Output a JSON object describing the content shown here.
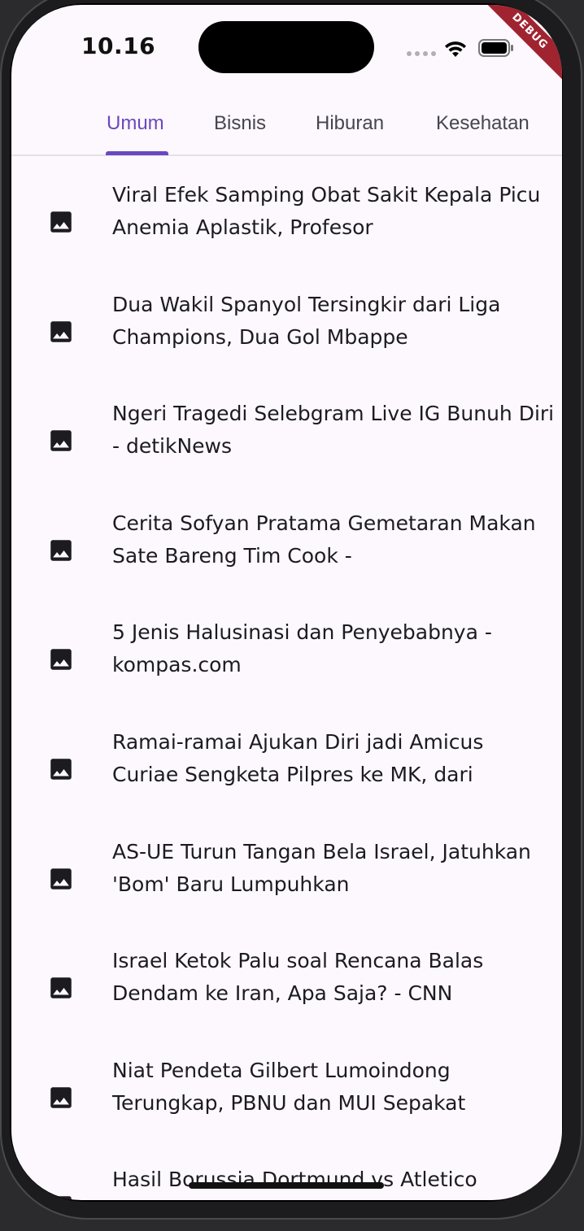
{
  "status_bar": {
    "time": "10.16",
    "icons": [
      "signal-dots-icon",
      "wifi-icon",
      "battery-icon"
    ]
  },
  "debug_banner": "DEBUG",
  "tabs": [
    {
      "label": "Umum",
      "active": true
    },
    {
      "label": "Bisnis",
      "active": false
    },
    {
      "label": "Hiburan",
      "active": false
    },
    {
      "label": "Kesehatan",
      "active": false
    }
  ],
  "news": [
    {
      "title": "Viral Efek Samping Obat Sakit Kepala Picu Anemia Aplastik, Profesor",
      "icon": "image-icon"
    },
    {
      "title": "Dua Wakil Spanyol Tersingkir dari Liga Champions, Dua Gol Mbappe",
      "icon": "image-icon"
    },
    {
      "title": "Ngeri Tragedi Selebgram Live IG Bunuh Diri - detikNews",
      "icon": "image-icon"
    },
    {
      "title": "Cerita Sofyan Pratama Gemetaran Makan Sate Bareng Tim Cook -",
      "icon": "image-icon"
    },
    {
      "title": "5 Jenis Halusinasi dan Penyebabnya - kompas.com",
      "icon": "image-icon"
    },
    {
      "title": "Ramai-ramai Ajukan Diri jadi Amicus Curiae Sengketa Pilpres ke MK, dari",
      "icon": "image-icon"
    },
    {
      "title": "AS-UE Turun Tangan Bela Israel, Jatuhkan 'Bom' Baru Lumpuhkan",
      "icon": "image-icon"
    },
    {
      "title": "Israel Ketok Palu soal Rencana Balas Dendam ke Iran, Apa Saja? - CNN",
      "icon": "image-icon"
    },
    {
      "title": "Niat Pendeta Gilbert Lumoindong Terungkap, PBNU dan MUI Sepakat",
      "icon": "image-icon"
    },
    {
      "title": "Hasil Borussia Dortmund vs Atletico",
      "icon": "image-icon"
    }
  ],
  "colors": {
    "accent": "#6a48c0",
    "background": "#fdf8fd",
    "text": "#1c1b20",
    "debug": "#a02430"
  }
}
